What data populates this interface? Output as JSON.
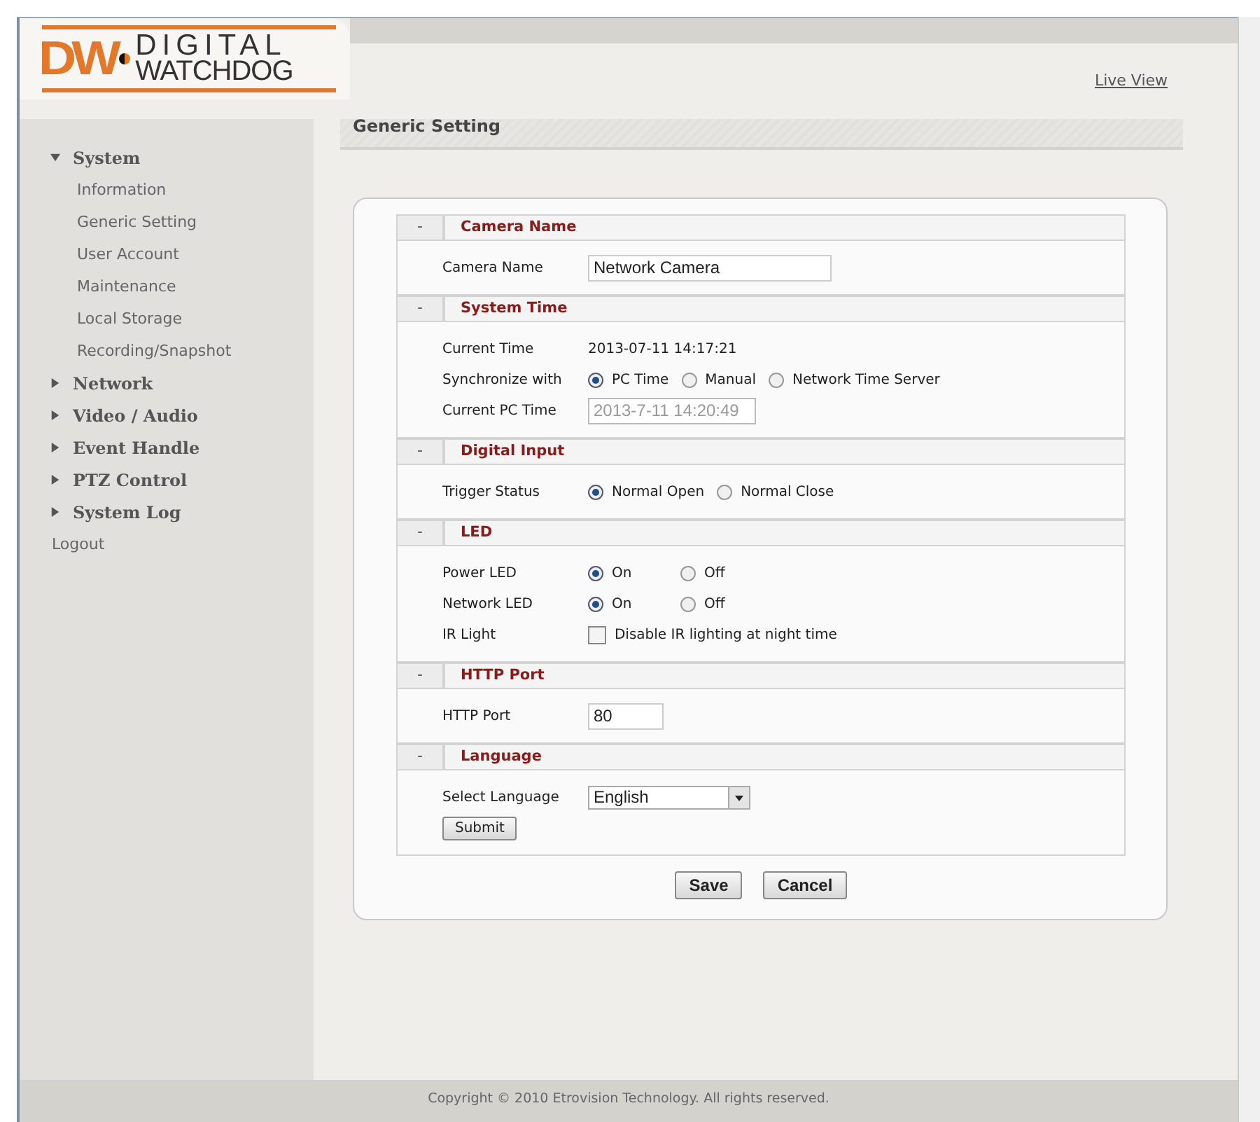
{
  "header": {
    "logo": {
      "mark": "DW",
      "brand_top": "DIGITAL",
      "brand_bottom": "WATCHDOG"
    },
    "live_view_link": "Live View"
  },
  "sidebar": {
    "items": [
      {
        "label": "System",
        "kind": "group",
        "expanded": true,
        "children": [
          {
            "label": "Information"
          },
          {
            "label": "Generic Setting"
          },
          {
            "label": "User Account"
          },
          {
            "label": "Maintenance"
          },
          {
            "label": "Local Storage"
          },
          {
            "label": "Recording/Snapshot"
          }
        ]
      },
      {
        "label": "Network",
        "kind": "group",
        "expanded": false
      },
      {
        "label": "Video / Audio",
        "kind": "group",
        "expanded": false
      },
      {
        "label": "Event Handle",
        "kind": "group",
        "expanded": false
      },
      {
        "label": "PTZ Control",
        "kind": "group",
        "expanded": false
      },
      {
        "label": "System Log",
        "kind": "group",
        "expanded": false
      },
      {
        "label": "Logout",
        "kind": "link"
      }
    ]
  },
  "page_title": "Generic Setting",
  "sections": [
    {
      "toggle": "-",
      "title": "Camera Name",
      "rows": [
        {
          "kind": "text_input",
          "label": "Camera Name",
          "value": "Network Camera"
        }
      ]
    },
    {
      "toggle": "-",
      "title": "System Time",
      "rows": [
        {
          "kind": "text",
          "label": "Current Time",
          "value": "2013-07-11 14:17:21"
        },
        {
          "kind": "radio",
          "label": "Synchronize with",
          "options": [
            {
              "label": "PC Time",
              "selected": true
            },
            {
              "label": "Manual",
              "selected": false
            },
            {
              "label": "Network Time Server",
              "selected": false
            }
          ]
        },
        {
          "kind": "text_input",
          "label": "Current PC Time",
          "value": "2013-7-11 14:20:49",
          "disabled": true
        }
      ]
    },
    {
      "toggle": "-",
      "title": "Digital Input",
      "rows": [
        {
          "kind": "radio",
          "label": "Trigger Status",
          "options": [
            {
              "label": "Normal Open",
              "selected": true
            },
            {
              "label": "Normal Close",
              "selected": false
            }
          ]
        }
      ]
    },
    {
      "toggle": "-",
      "title": "LED",
      "rows": [
        {
          "kind": "radio",
          "label": "Power LED",
          "options": [
            {
              "label": "On",
              "selected": true
            },
            {
              "label": "Off",
              "selected": false
            }
          ]
        },
        {
          "kind": "radio",
          "label": "Network LED",
          "options": [
            {
              "label": "On",
              "selected": true
            },
            {
              "label": "Off",
              "selected": false
            }
          ]
        },
        {
          "kind": "checkbox",
          "label": "IR Light",
          "option": "Disable IR lighting at night time",
          "checked": false
        }
      ]
    },
    {
      "toggle": "-",
      "title": "HTTP Port",
      "rows": [
        {
          "kind": "short_input",
          "label": "HTTP Port",
          "value": "80"
        }
      ]
    },
    {
      "toggle": "-",
      "title": "Language",
      "rows": [
        {
          "kind": "select",
          "label": "Select Language",
          "value": "English"
        },
        {
          "kind": "button",
          "label": "Submit"
        }
      ]
    }
  ],
  "buttons": [
    "Save",
    "Cancel"
  ],
  "footer": "Copyright © 2010 Etrovision Technology. All rights reserved."
}
